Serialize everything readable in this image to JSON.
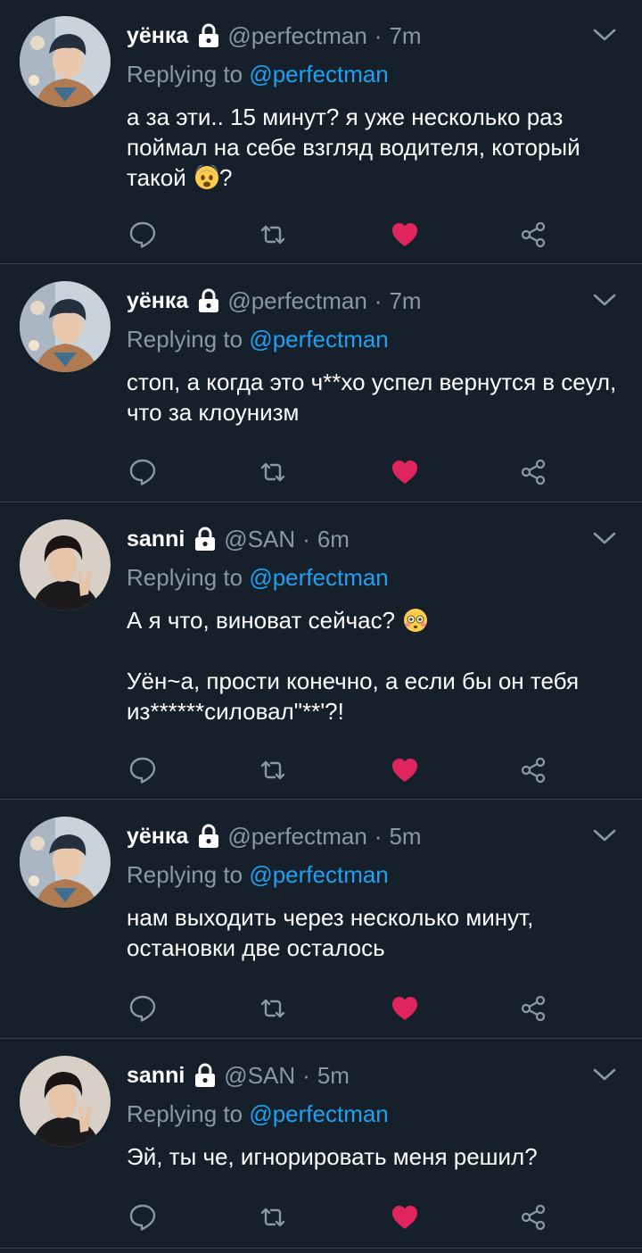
{
  "colors": {
    "background": "#15202b",
    "divider": "#38444d",
    "secondary_text": "#8899a6",
    "mention": "#1da1f2",
    "like_active": "#e0245e"
  },
  "tweets": [
    {
      "name": "уёнка",
      "handle": "@perfectman",
      "separator": "·",
      "time": "7m",
      "replying_prefix": "Replying to",
      "replying_to": "@perfectman",
      "paragraphs": [
        {
          "text": "а за эти.. 15 минут? я уже несколько раз поймал на себе взгляд водителя, который такой ",
          "emoji": "fearful-face-emoji",
          "after": "?"
        }
      ],
      "avatar_icon": "avatar-icon",
      "liked": true
    },
    {
      "name": "уёнка",
      "handle": "@perfectman",
      "separator": "·",
      "time": "7m",
      "replying_prefix": "Replying to",
      "replying_to": "@perfectman",
      "paragraphs": [
        {
          "text": "стоп, а когда это ч**хо успел вернутся в сеул, что за клоунизм"
        }
      ],
      "avatar_icon": "avatar-icon",
      "liked": true
    },
    {
      "name": "sanni",
      "handle": "@SAN",
      "separator": "·",
      "time": "6m",
      "replying_prefix": "Replying to",
      "replying_to": "@perfectman",
      "paragraphs": [
        {
          "text": "А я что, виноват сейчас? ",
          "emoji": "flushed-face-emoji"
        },
        {
          "text": "Уён~а, прости конечно, а если бы он тебя из******силовал\"**'?!"
        }
      ],
      "avatar_icon": "avatar-icon",
      "liked": true
    },
    {
      "name": "уёнка",
      "handle": "@perfectman",
      "separator": "·",
      "time": "5m",
      "replying_prefix": "Replying to",
      "replying_to": "@perfectman",
      "paragraphs": [
        {
          "text": "нам выходить через несколько минут, остановки две осталось"
        }
      ],
      "avatar_icon": "avatar-icon",
      "liked": true
    },
    {
      "name": "sanni",
      "handle": "@SAN",
      "separator": "·",
      "time": "5m",
      "replying_prefix": "Replying to",
      "replying_to": "@perfectman",
      "paragraphs": [
        {
          "text": "Эй, ты че, игнорировать меня решил?"
        }
      ],
      "avatar_icon": "avatar-icon",
      "liked": true
    }
  ],
  "action_icons": [
    "reply-icon",
    "retweet-icon",
    "like-icon",
    "share-icon"
  ]
}
